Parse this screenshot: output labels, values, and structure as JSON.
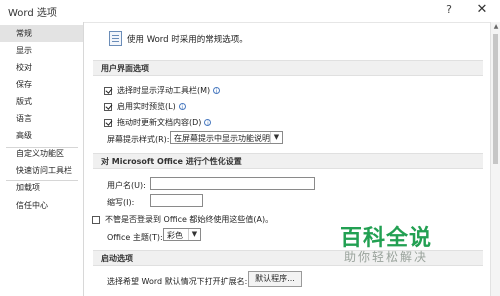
{
  "window": {
    "title": "Word 选项",
    "help_glyph": "?",
    "close_glyph": "✕"
  },
  "sidebar": {
    "items": [
      {
        "label": "常规"
      },
      {
        "label": "显示"
      },
      {
        "label": "校对"
      },
      {
        "label": "保存"
      },
      {
        "label": "版式"
      },
      {
        "label": "语言"
      },
      {
        "label": "高级"
      },
      {
        "label": "自定义功能区"
      },
      {
        "label": "快速访问工具栏"
      },
      {
        "label": "加载项"
      },
      {
        "label": "信任中心"
      }
    ]
  },
  "main": {
    "intro": "使用 Word 时采用的常规选项。",
    "ui_section": {
      "title": "用户界面选项",
      "options": [
        {
          "label": "选择时显示浮动工具栏(M)",
          "checked": true
        },
        {
          "label": "启用实时预览(L)",
          "checked": true
        },
        {
          "label": "拖动时更新文档内容(D)",
          "checked": true
        }
      ],
      "tooltip_label": "屏幕提示样式(R):",
      "tooltip_value": "在屏幕提示中显示功能说明"
    },
    "personalize_section": {
      "title": "对 Microsoft Office 进行个性化设置",
      "username_label": "用户名(U):",
      "initials_label": "缩写(I):",
      "always_use_label": "不管是否登录到 Office 都始终使用这些值(A)。",
      "theme_label": "Office 主题(T):",
      "theme_value": "彩色"
    },
    "startup_section": {
      "title": "启动选项",
      "default_program_label": "选择希望 Word 默认情况下打开扩展名:",
      "default_program_button": "默认程序..."
    }
  },
  "watermark": {
    "main": "百科全说",
    "sub": "助你轻松解决"
  },
  "colors": {
    "accent": "#22a052",
    "active_nav": "#e3e3e3",
    "section_bg": "#f0f0f0"
  }
}
